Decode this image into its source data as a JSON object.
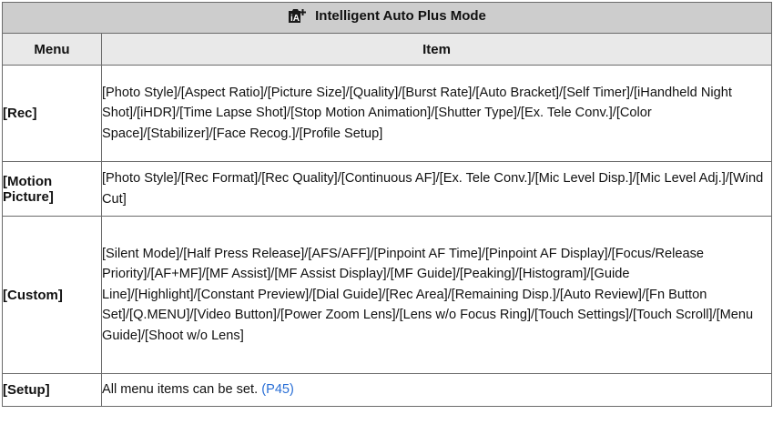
{
  "table": {
    "title": "Intelligent Auto Plus Mode",
    "title_icon": "intelligent-auto-plus-icon",
    "headers": {
      "menu": "Menu",
      "item": "Item"
    },
    "rows": [
      {
        "menu": "[Rec]",
        "items": "[Photo Style]/[Aspect Ratio]/[Picture Size]/[Quality]/[Burst Rate]/[Auto Bracket]/[Self Timer]/[iHandheld Night Shot]/[iHDR]/[Time Lapse Shot]/[Stop Motion Animation]/[Shutter Type]/[Ex. Tele Conv.]/[Color Space]/[Stabilizer]/[Face Recog.]/[Profile Setup]"
      },
      {
        "menu": "[Motion Picture]",
        "items": "[Photo Style]/[Rec Format]/[Rec Quality]/[Continuous AF]/[Ex. Tele Conv.]/[Mic Level Disp.]/[Mic Level Adj.]/[Wind Cut]"
      },
      {
        "menu": "[Custom]",
        "items": "[Silent Mode]/[Half Press Release]/[AFS/AFF]/[Pinpoint AF Time]/[Pinpoint AF Display]/[Focus/Release Priority]/[AF+MF]/[MF Assist]/[MF Assist Display]/[MF Guide]/[Peaking]/[Histogram]/[Guide Line]/[Highlight]/[Constant Preview]/[Dial Guide]/[Rec Area]/[Remaining Disp.]/[Auto Review]/[Fn Button Set]/[Q.MENU]/[Video Button]/[Power Zoom Lens]/[Lens w/o Focus Ring]/[Touch Settings]/[Touch Scroll]/[Menu Guide]/[Shoot w/o Lens]"
      },
      {
        "menu": "[Setup]",
        "items": "All menu items can be set.",
        "page_ref": "(P45)"
      }
    ]
  },
  "colors": {
    "title_bg": "#cdcdcd",
    "header_bg": "#e9e9e9",
    "border": "#6b6b6b",
    "link": "#2a6fd6"
  }
}
